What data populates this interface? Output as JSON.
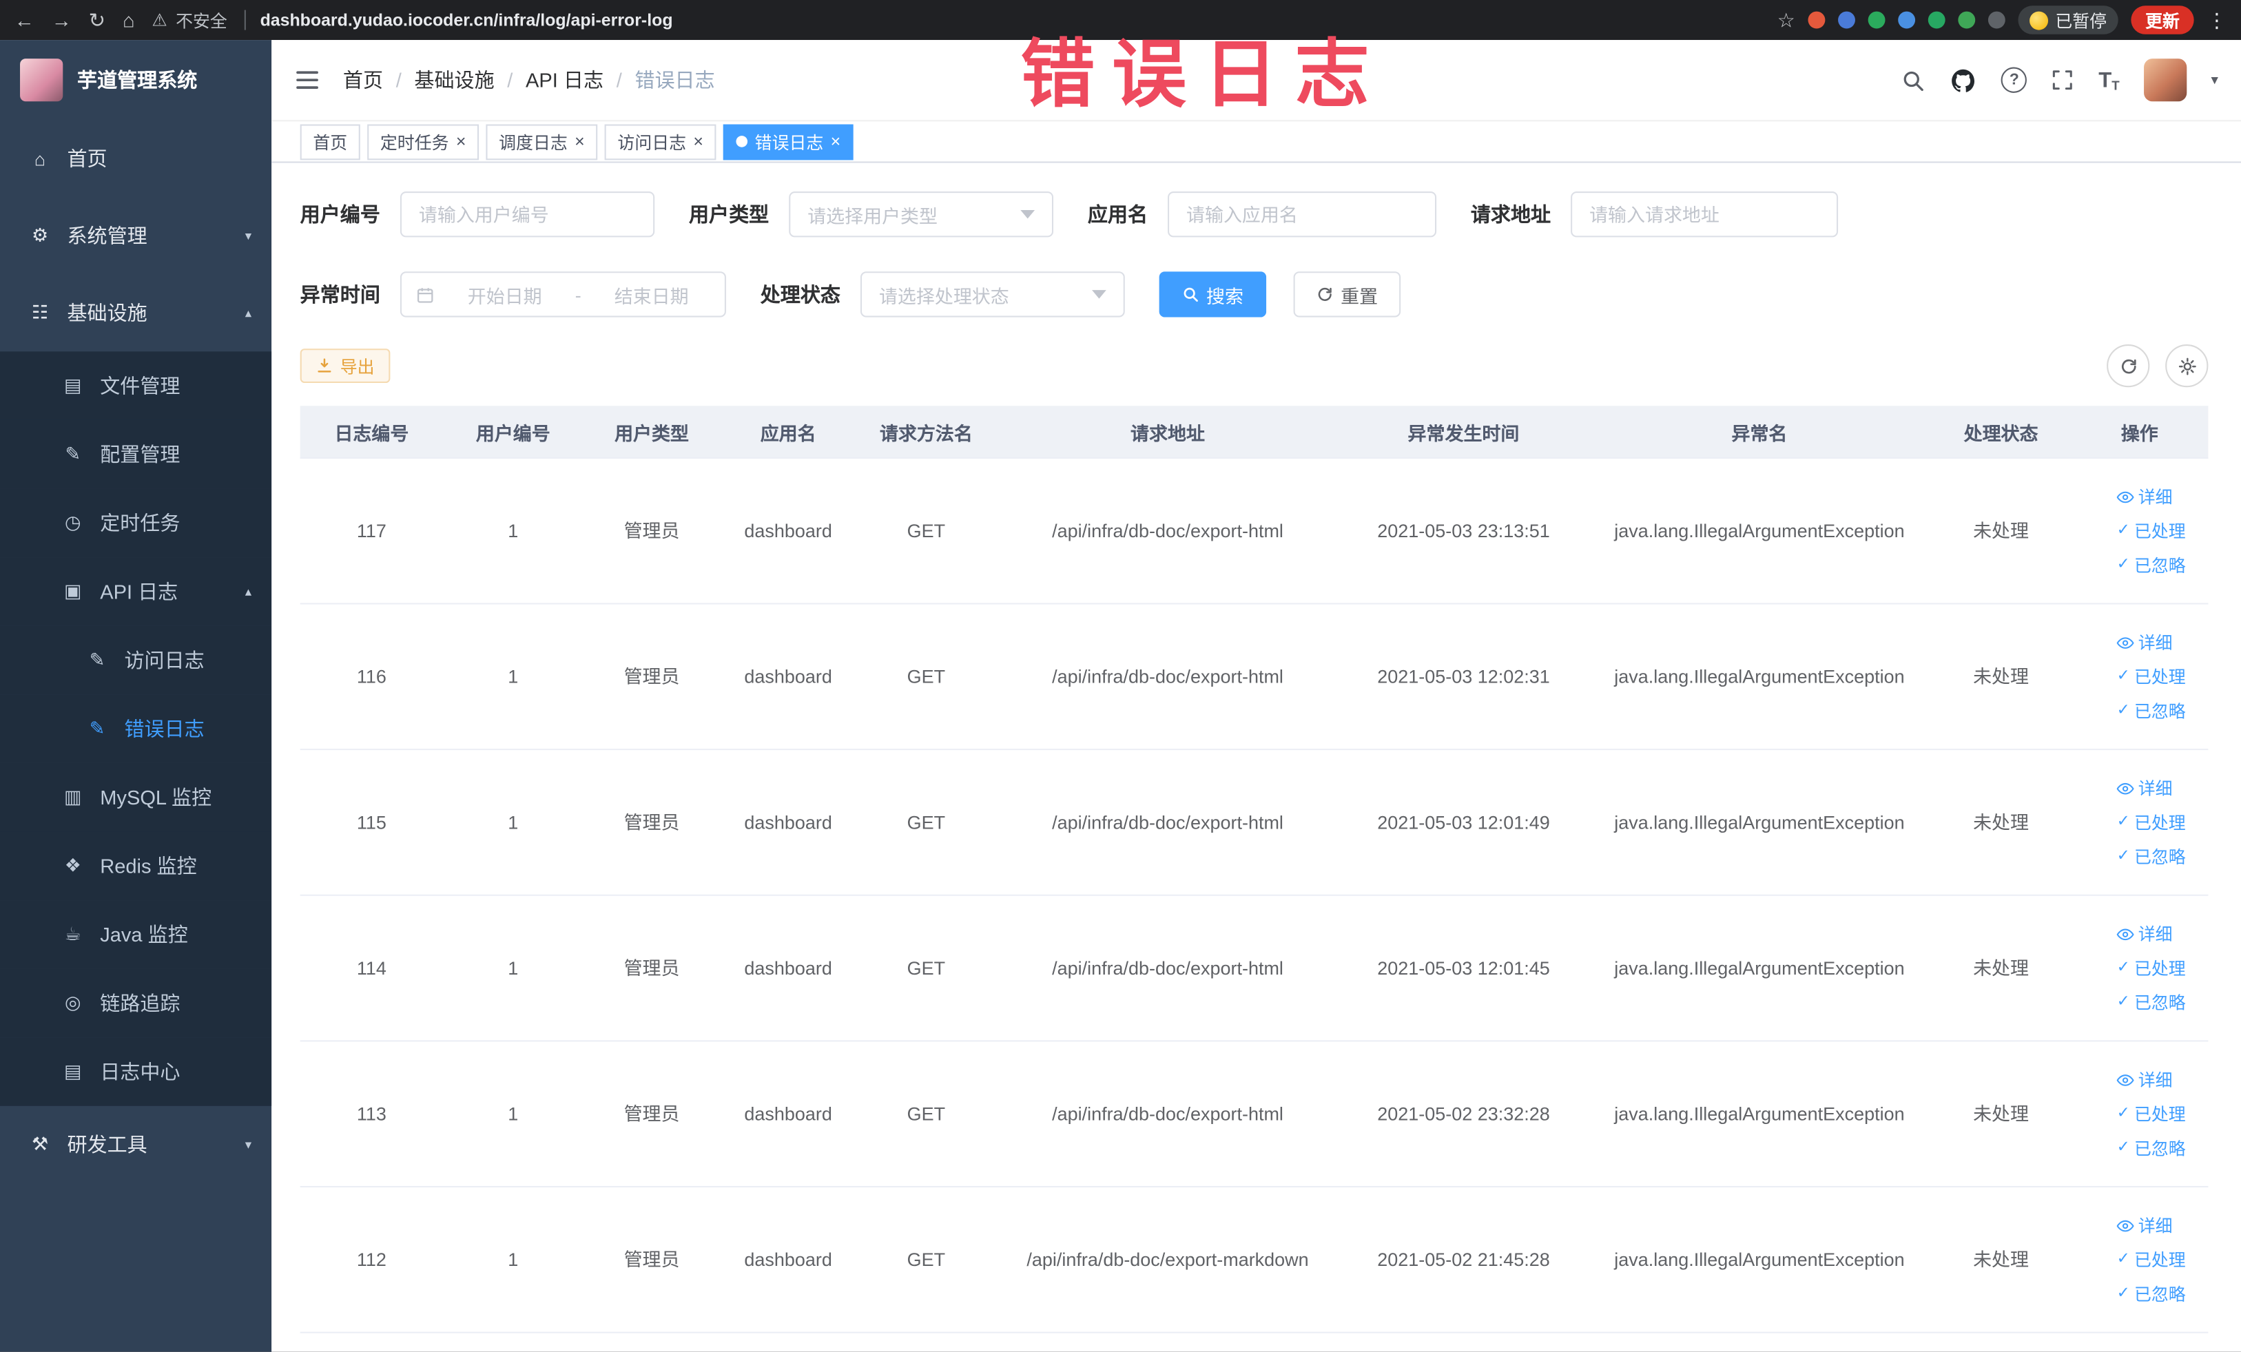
{
  "annotation": {
    "text": "错误日志",
    "color": "#ee4a5e"
  },
  "glyphs": {
    "back": "←",
    "forward": "→",
    "reload": "↻",
    "home": "⌂",
    "warning": "⚠",
    "star": "☆",
    "kebab": "⋮",
    "caret_down": "▾",
    "help": "?",
    "font_size": "T",
    "check": "✓",
    "close": "×",
    "breadcrumb_sep": "/",
    "chevron_up": "▴",
    "chevron_down": "▾"
  },
  "browser": {
    "security_label": "不安全",
    "url": "dashboard.yudao.iocoder.cn/infra/log/api-error-log",
    "paused_badge": "已暂停",
    "update_label": "更新",
    "extensions": [
      {
        "name": "extension-red",
        "color": "#e4593c"
      },
      {
        "name": "extension-blue",
        "color": "#4a7bd8"
      },
      {
        "name": "extension-green-check",
        "color": "#2bab5d"
      },
      {
        "name": "extension-grid",
        "color": "#4a90e2"
      },
      {
        "name": "extension-on-badge",
        "color": "#27a862"
      },
      {
        "name": "extension-leaf",
        "color": "#3fa757"
      },
      {
        "name": "extension-dark",
        "color": "#5f6368"
      }
    ]
  },
  "sidebar": {
    "logo_title": "芋道管理系统",
    "items": [
      {
        "name": "home",
        "label": "首页",
        "icon": "home-icon",
        "glyph": "⌂",
        "level": 0
      },
      {
        "name": "system-management",
        "label": "系统管理",
        "icon": "gear-icon",
        "glyph": "⚙",
        "level": 0,
        "chevron": "down"
      },
      {
        "name": "infrastructure",
        "label": "基础设施",
        "icon": "infrastructure-icon",
        "glyph": "☷",
        "level": 0,
        "chevron": "up"
      },
      {
        "name": "file-management",
        "label": "文件管理",
        "icon": "file-icon",
        "glyph": "▤",
        "level": 1
      },
      {
        "name": "config-management",
        "label": "配置管理",
        "icon": "config-icon",
        "glyph": "✎",
        "level": 1
      },
      {
        "name": "scheduled-tasks",
        "label": "定时任务",
        "icon": "timer-icon",
        "glyph": "◷",
        "level": 1
      },
      {
        "name": "api-log",
        "label": "API 日志",
        "icon": "api-log-icon",
        "glyph": "▣",
        "level": 1,
        "chevron": "up"
      },
      {
        "name": "access-log",
        "label": "访问日志",
        "icon": "access-log-icon",
        "glyph": "✎",
        "level": 2
      },
      {
        "name": "error-log",
        "label": "错误日志",
        "icon": "error-log-icon",
        "glyph": "✎",
        "level": 2,
        "active": true
      },
      {
        "name": "mysql-monitor",
        "label": "MySQL 监控",
        "icon": "mysql-icon",
        "glyph": "▥",
        "level": 1
      },
      {
        "name": "redis-monitor",
        "label": "Redis 监控",
        "icon": "redis-icon",
        "glyph": "❖",
        "level": 1
      },
      {
        "name": "java-monitor",
        "label": "Java 监控",
        "icon": "java-icon",
        "glyph": "☕",
        "level": 1
      },
      {
        "name": "trace",
        "label": "链路追踪",
        "icon": "trace-icon",
        "glyph": "◎",
        "level": 1
      },
      {
        "name": "log-center",
        "label": "日志中心",
        "icon": "log-center-icon",
        "glyph": "▤",
        "level": 1
      },
      {
        "name": "dev-tools",
        "label": "研发工具",
        "icon": "dev-tools-icon",
        "glyph": "⚒",
        "level": 0,
        "chevron": "down"
      }
    ]
  },
  "navbar": {
    "breadcrumb": [
      "首页",
      "基础设施",
      "API 日志",
      "错误日志"
    ]
  },
  "tabsbar": {
    "tabs": [
      {
        "name": "home",
        "label": "首页",
        "closable": false,
        "active": false
      },
      {
        "name": "scheduled-tasks",
        "label": "定时任务",
        "closable": true,
        "active": false
      },
      {
        "name": "schedule-log",
        "label": "调度日志",
        "closable": true,
        "active": false
      },
      {
        "name": "access-log",
        "label": "访问日志",
        "closable": true,
        "active": false
      },
      {
        "name": "error-log",
        "label": "错误日志",
        "closable": true,
        "active": true
      }
    ]
  },
  "filters": {
    "user_id": {
      "label": "用户编号",
      "placeholder": "请输入用户编号"
    },
    "user_type": {
      "label": "用户类型",
      "placeholder": "请选择用户类型"
    },
    "app_name": {
      "label": "应用名",
      "placeholder": "请输入应用名"
    },
    "request_url": {
      "label": "请求地址",
      "placeholder": "请输入请求地址"
    },
    "exception_time": {
      "label": "异常时间",
      "start_placeholder": "开始日期",
      "separator": "-",
      "end_placeholder": "结束日期"
    },
    "process_status": {
      "label": "处理状态",
      "placeholder": "请选择处理状态"
    },
    "search_label": "搜索",
    "reset_label": "重置"
  },
  "toolbar": {
    "export_label": "导出"
  },
  "table": {
    "columns": [
      "日志编号",
      "用户编号",
      "用户类型",
      "应用名",
      "请求方法名",
      "请求地址",
      "异常发生时间",
      "异常名",
      "处理状态",
      "操作"
    ],
    "actions": [
      {
        "name": "detail",
        "label": "详细"
      },
      {
        "name": "processed",
        "label": "已处理"
      },
      {
        "name": "ignored",
        "label": "已忽略"
      }
    ],
    "rows": [
      {
        "log_id": "117",
        "user_id": "1",
        "user_type": "管理员",
        "app_name": "dashboard",
        "method": "GET",
        "request_url": "/api/infra/db-doc/export-html",
        "time": "2021-05-03 23:13:51",
        "exception": "java.lang.IllegalArgumentException",
        "status": "未处理"
      },
      {
        "log_id": "116",
        "user_id": "1",
        "user_type": "管理员",
        "app_name": "dashboard",
        "method": "GET",
        "request_url": "/api/infra/db-doc/export-html",
        "time": "2021-05-03 12:02:31",
        "exception": "java.lang.IllegalArgumentException",
        "status": "未处理"
      },
      {
        "log_id": "115",
        "user_id": "1",
        "user_type": "管理员",
        "app_name": "dashboard",
        "method": "GET",
        "request_url": "/api/infra/db-doc/export-html",
        "time": "2021-05-03 12:01:49",
        "exception": "java.lang.IllegalArgumentException",
        "status": "未处理"
      },
      {
        "log_id": "114",
        "user_id": "1",
        "user_type": "管理员",
        "app_name": "dashboard",
        "method": "GET",
        "request_url": "/api/infra/db-doc/export-html",
        "time": "2021-05-03 12:01:45",
        "exception": "java.lang.IllegalArgumentException",
        "status": "未处理"
      },
      {
        "log_id": "113",
        "user_id": "1",
        "user_type": "管理员",
        "app_name": "dashboard",
        "method": "GET",
        "request_url": "/api/infra/db-doc/export-html",
        "time": "2021-05-02 23:32:28",
        "exception": "java.lang.IllegalArgumentException",
        "status": "未处理"
      },
      {
        "log_id": "112",
        "user_id": "1",
        "user_type": "管理员",
        "app_name": "dashboard",
        "method": "GET",
        "request_url": "/api/infra/db-doc/export-markdown",
        "time": "2021-05-02 21:45:28",
        "exception": "java.lang.IllegalArgumentException",
        "status": "未处理"
      }
    ]
  },
  "colors": {
    "accent": "#409eff",
    "warning": "#e6a23c",
    "sidebar_bg": "#304156",
    "submenu_bg": "#1f2d3d"
  }
}
